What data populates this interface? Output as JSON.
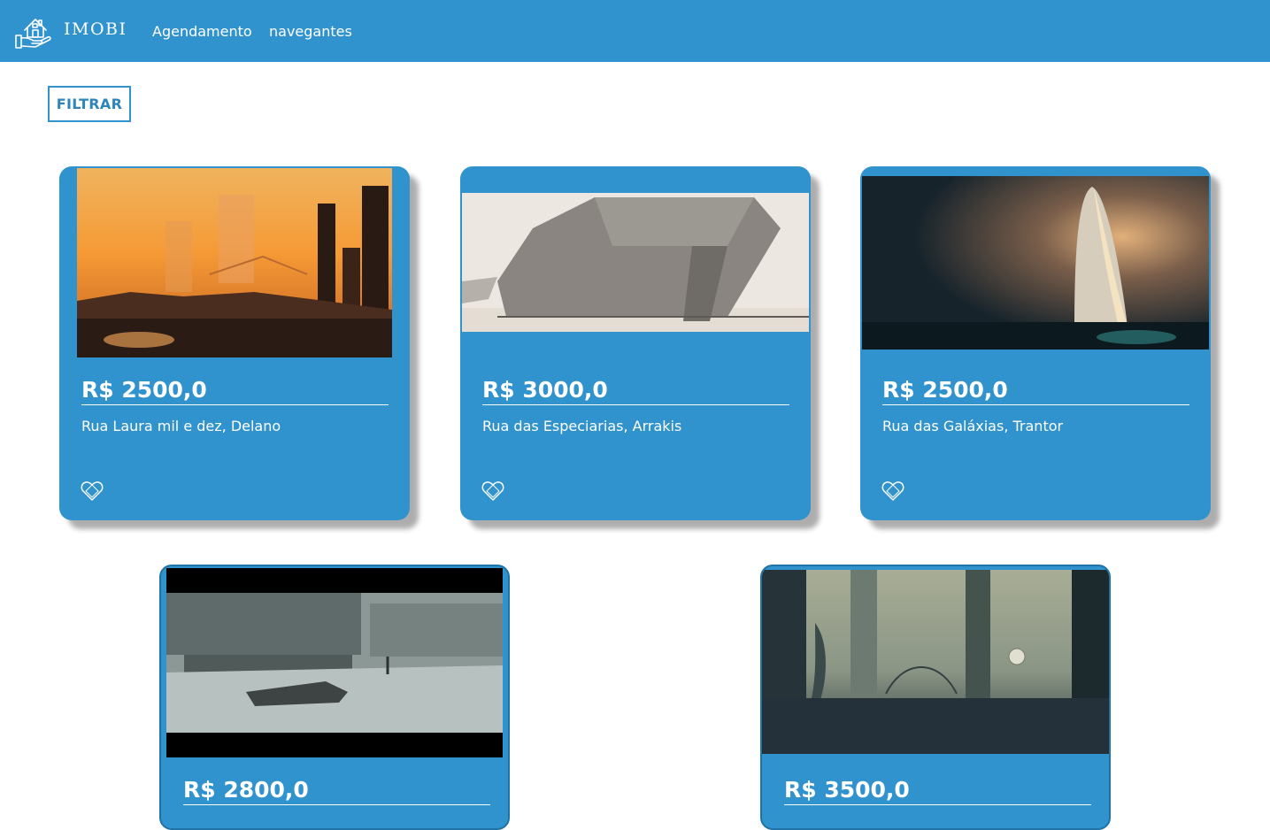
{
  "header": {
    "brand": "IMOBI",
    "logo_icon": "house-in-hands-icon",
    "nav": [
      {
        "label": "Agendamento"
      },
      {
        "label": "navegantes"
      }
    ],
    "background_color": "#3093cd"
  },
  "filter": {
    "label": "FILTRAR"
  },
  "listings": [
    {
      "price": "R$ 2500,0",
      "address": "Rua Laura mil e dez, Delano",
      "image": "sunset-futuristic-city-image",
      "favorite_icon": "heart-outline-icon"
    },
    {
      "price": "R$ 3000,0",
      "address": "Rua das Especiarias, Arrakis",
      "image": "desert-megastructure-image",
      "favorite_icon": "heart-outline-icon"
    },
    {
      "price": "R$ 2500,0",
      "address": "Rua das Galáxias, Trantor",
      "image": "cosmic-monolith-image",
      "favorite_icon": "heart-outline-icon"
    },
    {
      "price": "R$ 2800,0",
      "address": "",
      "image": "brutalist-building-car-image",
      "favorite_icon": "heart-outline-icon"
    },
    {
      "price": "R$ 3500,0",
      "address": "",
      "image": "misty-cyberpunk-city-image",
      "favorite_icon": "heart-outline-icon"
    }
  ],
  "card_color": "#3093cd"
}
